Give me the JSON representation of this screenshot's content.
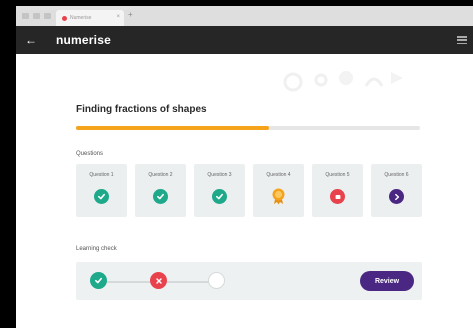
{
  "browser": {
    "tab_title": "Numerise",
    "tab_close": "×",
    "new_tab": "+"
  },
  "header": {
    "back_icon": "←",
    "logo": "numerise"
  },
  "lesson": {
    "title": "Finding fractions of shapes",
    "progress": 0.56
  },
  "questions": {
    "label": "Questions",
    "items": [
      {
        "label": "Question 1",
        "status": "correct",
        "icon": "check-icon"
      },
      {
        "label": "Question 2",
        "status": "correct",
        "icon": "check-icon"
      },
      {
        "label": "Question 3",
        "status": "correct",
        "icon": "check-icon"
      },
      {
        "label": "Question 4",
        "status": "award",
        "icon": "award-icon"
      },
      {
        "label": "Question 5",
        "status": "incorrect",
        "icon": "flag-icon"
      },
      {
        "label": "Question 6",
        "status": "current",
        "icon": "arrow-right-icon"
      }
    ]
  },
  "learning_check": {
    "label": "Learning check",
    "steps": [
      "correct",
      "incorrect",
      "pending"
    ],
    "review_label": "Review"
  },
  "colors": {
    "accent": "#f5a31a",
    "correct": "#1ea98a",
    "incorrect": "#e8434d",
    "primary": "#4b2784",
    "header_bg": "#262626"
  }
}
